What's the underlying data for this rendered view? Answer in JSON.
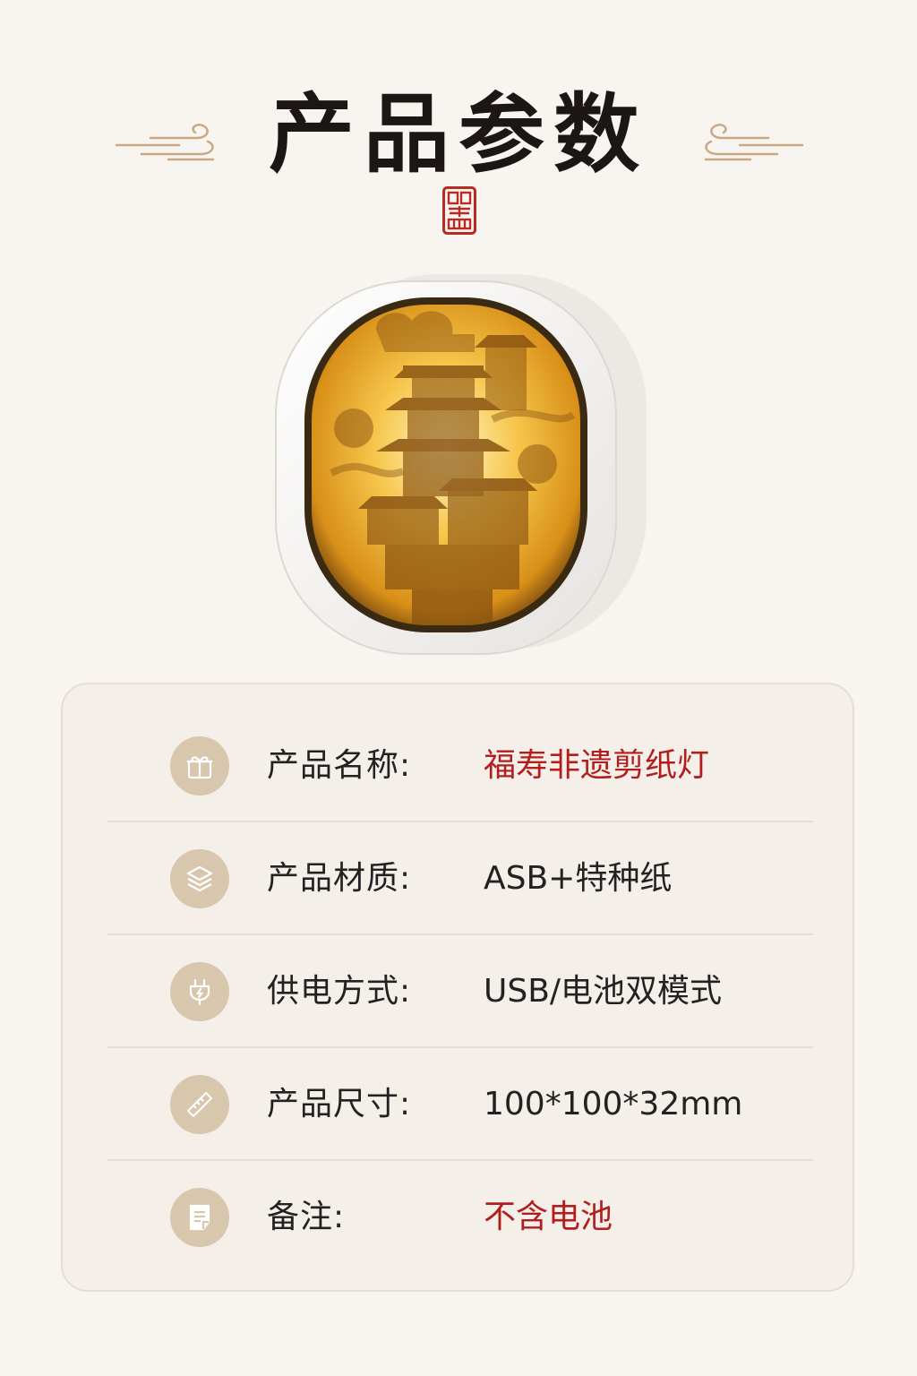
{
  "title": "产品参数",
  "specs": [
    {
      "label": "产品名称:",
      "value": "福寿非遗剪纸灯",
      "icon": "gift-icon",
      "highlight": true
    },
    {
      "label": "产品材质:",
      "value": "ASB+特种纸",
      "icon": "layers-icon",
      "highlight": false
    },
    {
      "label": "供电方式:",
      "value": "USB/电池双模式",
      "icon": "plug-icon",
      "highlight": false
    },
    {
      "label": "产品尺寸:",
      "value": "100*100*32mm",
      "icon": "ruler-icon",
      "highlight": false
    },
    {
      "label": "备注:",
      "value": "不含电池",
      "icon": "note-icon",
      "highlight": true
    }
  ],
  "colors": {
    "background": "#f8f5f1",
    "title": "#1c1714",
    "accent_red": "#b21e1e",
    "icon_circle": "#d8c6ad",
    "lamp_glow": "#f2b430"
  }
}
